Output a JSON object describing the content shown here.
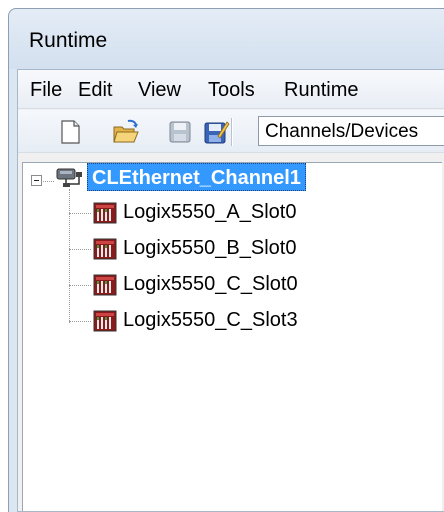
{
  "window": {
    "title": "Runtime"
  },
  "menu": {
    "items": [
      "File",
      "Edit",
      "View",
      "Tools",
      "Runtime"
    ]
  },
  "toolbar": {
    "buttons": [
      {
        "name": "new-icon"
      },
      {
        "name": "open-folder-icon"
      },
      {
        "name": "save-icon"
      },
      {
        "name": "save-as-icon"
      }
    ],
    "view_selector": "Channels/Devices"
  },
  "tree": {
    "channel": {
      "label": "CLEthernet_Channel1",
      "icon": "network-channel-icon",
      "expanded": true,
      "selected": true
    },
    "devices": [
      {
        "label": "Logix5550_A_Slot0",
        "icon": "plc-device-icon"
      },
      {
        "label": "Logix5550_B_Slot0",
        "icon": "plc-device-icon"
      },
      {
        "label": "Logix5550_C_Slot0",
        "icon": "plc-device-icon"
      },
      {
        "label": "Logix5550_C_Slot3",
        "icon": "plc-device-icon"
      }
    ]
  },
  "colors": {
    "selection": "#3399ff",
    "window_frame": "#dbe6f3"
  }
}
